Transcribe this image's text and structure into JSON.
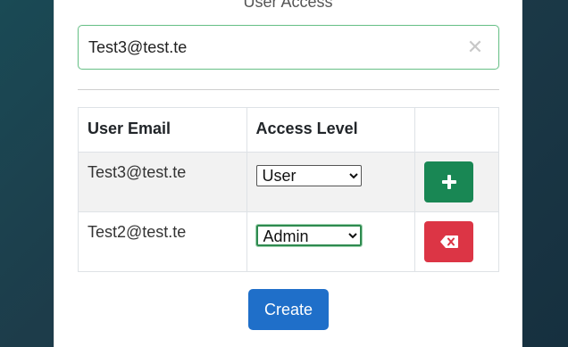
{
  "section": {
    "title": "User Access"
  },
  "email_input": {
    "value": "Test3@test.te",
    "clear_glyph": "✕"
  },
  "table": {
    "headers": {
      "email": "User Email",
      "access_level": "Access Level",
      "action": ""
    },
    "rows": [
      {
        "email": "Test3@test.te",
        "access_level": "User",
        "action_icon": "plus-icon"
      },
      {
        "email": "Test2@test.te",
        "access_level": "Admin",
        "action_icon": "backspace-icon"
      }
    ]
  },
  "access_options": {
    "user": "User",
    "admin": "Admin"
  },
  "create_button": {
    "label": "Create"
  },
  "colors": {
    "add": "#198754",
    "remove": "#dc3545",
    "primary": "#1f6fc9",
    "focus_border": "#6cc28a"
  }
}
